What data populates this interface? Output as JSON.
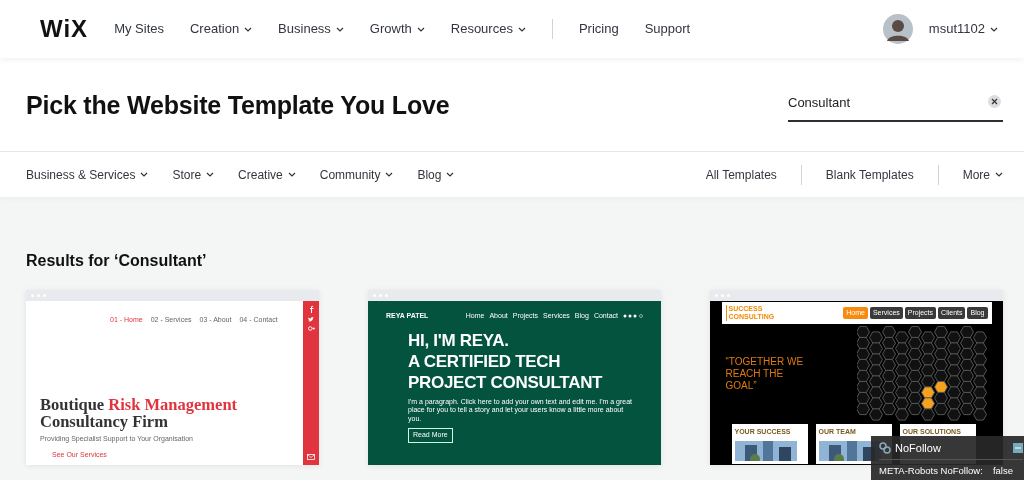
{
  "nav": {
    "logo": "WiX",
    "items": [
      {
        "label": "My Sites",
        "dropdown": false
      },
      {
        "label": "Creation",
        "dropdown": true
      },
      {
        "label": "Business",
        "dropdown": true
      },
      {
        "label": "Growth",
        "dropdown": true
      },
      {
        "label": "Resources",
        "dropdown": true
      }
    ],
    "links": [
      "Pricing",
      "Support"
    ],
    "user": {
      "name": "msut1102"
    }
  },
  "header": {
    "title": "Pick the Website Template You Love",
    "search": {
      "value": "Consultant"
    }
  },
  "categories": [
    {
      "label": "Business & Services",
      "dropdown": true
    },
    {
      "label": "Store",
      "dropdown": true
    },
    {
      "label": "Creative",
      "dropdown": true
    },
    {
      "label": "Community",
      "dropdown": true
    },
    {
      "label": "Blog",
      "dropdown": true
    }
  ],
  "right_links": [
    {
      "label": "All Templates",
      "dropdown": false
    },
    {
      "label": "Blank Templates",
      "dropdown": false
    },
    {
      "label": "More",
      "dropdown": true
    }
  ],
  "results_heading": "Results for ‘Consultant’",
  "templates": [
    {
      "kind": "risk",
      "menu": [
        {
          "label": "01 - Home",
          "selected": true
        },
        {
          "label": "02 - Services",
          "selected": false
        },
        {
          "label": "03 - About",
          "selected": false
        },
        {
          "label": "04 - Contact",
          "selected": false
        }
      ],
      "headline_start": "Boutique",
      "headline_accent": "Risk Management",
      "headline_end": "Consultancy Firm",
      "subtitle": "Providing Specialist Support to Your Organisation",
      "cta": "See Our Services"
    },
    {
      "kind": "reya",
      "logo": "REYA PATEL",
      "menu": [
        {
          "label": "Home"
        },
        {
          "label": "About"
        },
        {
          "label": "Projects"
        },
        {
          "label": "Services"
        },
        {
          "label": "Blog"
        },
        {
          "label": "Contact"
        }
      ],
      "headline": [
        "HI, I'M REYA.",
        "A CERTIFIED TECH",
        "PROJECT CONSULTANT"
      ],
      "paragraph": "I'm a paragraph. Click here to add your own text and edit me. I'm a great place for you to tell a story and let your users know a little more about you.",
      "cta": "Read More"
    },
    {
      "kind": "success",
      "logo": "SUCCESS CONSULTING",
      "menu": [
        {
          "label": "Home",
          "selected": true
        },
        {
          "label": "Services",
          "selected": false
        },
        {
          "label": "Projects",
          "selected": false
        },
        {
          "label": "Clients",
          "selected": false
        },
        {
          "label": "Blog",
          "selected": false
        }
      ],
      "quote": "“TOGETHER WE REACH THE GOAL”",
      "boxes": [
        "YOUR SUCCESS",
        "OUR TEAM",
        "OUR SOLUTIONS"
      ]
    }
  ],
  "popup": {
    "title": "NoFollow",
    "rows": [
      {
        "label": "META-Robots NoFollow:",
        "value": "false"
      }
    ]
  }
}
